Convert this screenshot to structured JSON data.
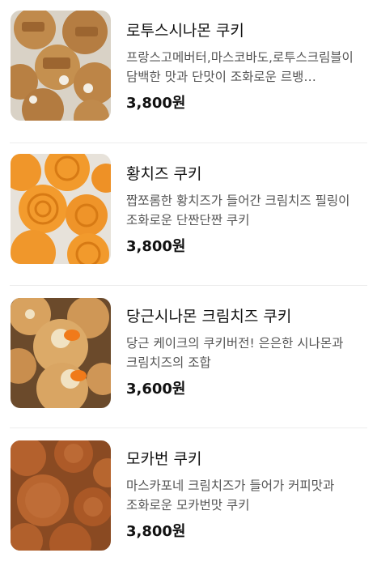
{
  "menu": {
    "items": [
      {
        "name": "로투스시나몬 쿠키",
        "description": "프랑스고메버터,마스코바도,로투스크림블이 담백한 맛과 단맛이 조화로운 르뱅…",
        "price": "3,800원",
        "image": "lotus-cinnamon-cookie-photo"
      },
      {
        "name": "황치즈 쿠키",
        "description": "짭쪼롬한 황치즈가 들어간 크림치즈 필링이 조화로운 단짠단짠 쿠키",
        "price": "3,800원",
        "image": "yellow-cheese-cookie-photo"
      },
      {
        "name": "당근시나몬 크림치즈 쿠키",
        "description": "당근 케이크의 쿠키버전! 은은한 시나몬과 크림치즈의 조합",
        "price": "3,600원",
        "image": "carrot-cinnamon-cookie-photo"
      },
      {
        "name": "모카번 쿠키",
        "description": "마스카포네 크림치즈가 들어가 커피맛과 조화로운 모카번맛 쿠키",
        "price": "3,800원",
        "image": "mocha-bun-cookie-photo"
      }
    ]
  }
}
